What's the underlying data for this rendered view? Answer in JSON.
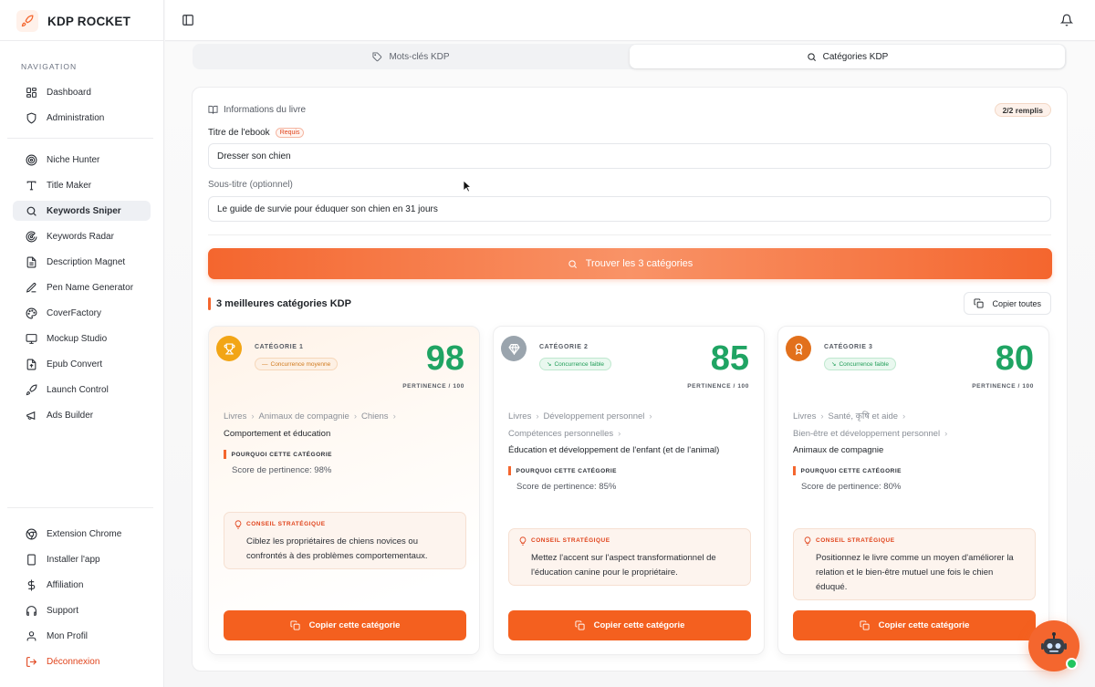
{
  "app": {
    "name": "KDP ROCKET"
  },
  "sidebar": {
    "nav_title": "NAVIGATION",
    "group1": [
      {
        "label": "Dashboard",
        "icon": "grid-icon"
      },
      {
        "label": "Administration",
        "icon": "shield-icon"
      }
    ],
    "group2": [
      {
        "label": "Niche Hunter",
        "icon": "target-icon"
      },
      {
        "label": "Title Maker",
        "icon": "text-icon"
      },
      {
        "label": "Keywords Sniper",
        "icon": "search-icon",
        "active": true
      },
      {
        "label": "Keywords Radar",
        "icon": "radar-icon"
      },
      {
        "label": "Description Magnet",
        "icon": "file-icon"
      },
      {
        "label": "Pen Name Generator",
        "icon": "pen-icon"
      },
      {
        "label": "CoverFactory",
        "icon": "palette-icon"
      },
      {
        "label": "Mockup Studio",
        "icon": "monitor-icon"
      },
      {
        "label": "Epub Convert",
        "icon": "file-up-icon"
      },
      {
        "label": "Launch Control",
        "icon": "rocket-icon"
      },
      {
        "label": "Ads Builder",
        "icon": "megaphone-icon"
      }
    ],
    "group3": [
      {
        "label": "Extension Chrome",
        "icon": "chrome-icon"
      },
      {
        "label": "Installer l'app",
        "icon": "phone-icon"
      },
      {
        "label": "Affiliation",
        "icon": "dollar-icon"
      },
      {
        "label": "Support",
        "icon": "headphones-icon"
      },
      {
        "label": "Mon Profil",
        "icon": "user-icon"
      },
      {
        "label": "Déconnexion",
        "icon": "logout-icon"
      }
    ]
  },
  "tabs": [
    {
      "label": "Mots-clés KDP",
      "icon": "tag-icon"
    },
    {
      "label": "Catégories KDP",
      "icon": "search-icon",
      "active": true
    }
  ],
  "form": {
    "section_title": "Informations du livre",
    "filled_badge": "2/2 remplis",
    "title_label": "Titre de l'ebook",
    "required_badge": "Requis",
    "title_value": "Dresser son chien",
    "subtitle_label": "Sous-titre (optionnel)",
    "subtitle_value": "Le guide de survie pour éduquer son chien en 31 jours",
    "find_button": "Trouver les 3 catégories"
  },
  "results": {
    "title": "3 meilleures catégories KDP",
    "copy_all": "Copier toutes",
    "why_label": "POURQUOI CETTE CATÉGORIE",
    "tip_label": "CONSEIL STRATÉGIQUE",
    "score_label": "PERTINENCE / 100",
    "copy_button": "Copier cette catégorie",
    "cards": [
      {
        "cat_label": "CATÉGORIE 1",
        "competition": "Concurrence moyenne",
        "competition_level": "mid",
        "score": "98",
        "medal_color": "#f2a515",
        "crumb_lines": [
          [
            "Livres",
            "Animaux de compagnie",
            "Chiens"
          ],
          [
            "Comportement et éducation"
          ]
        ],
        "why_text": "Score de pertinence: 98%",
        "tip_text": "Ciblez les propriétaires de chiens novices ou confrontés à des problèmes comportementaux."
      },
      {
        "cat_label": "CATÉGORIE 2",
        "competition": "Concurrence faible",
        "competition_level": "low",
        "score": "85",
        "medal_color": "#9aa4ad",
        "crumb_lines": [
          [
            "Livres",
            "Développement personnel"
          ],
          [
            "Compétences personnelles"
          ],
          [
            "Éducation et développement de l'enfant (et de l'animal)"
          ]
        ],
        "why_text": "Score de pertinence: 85%",
        "tip_text": "Mettez l'accent sur l'aspect transformationnel de l'éducation canine pour le propriétaire."
      },
      {
        "cat_label": "CATÉGORIE 3",
        "competition": "Concurrence faible",
        "competition_level": "low",
        "score": "80",
        "medal_color": "#e2701c",
        "crumb_lines": [
          [
            "Livres",
            "Santé, कृषि et aide"
          ],
          [
            "Bien-être et développement personnel"
          ],
          [
            "Animaux de compagnie"
          ]
        ],
        "why_text": "Score de pertinence: 80%",
        "tip_text": "Positionnez le livre comme un moyen d'améliorer la relation et le bien-être mutuel une fois le chien éduqué."
      }
    ]
  },
  "colors": {
    "accent": "#f4662e",
    "score": "#1fa463",
    "danger": "#e0431b"
  }
}
